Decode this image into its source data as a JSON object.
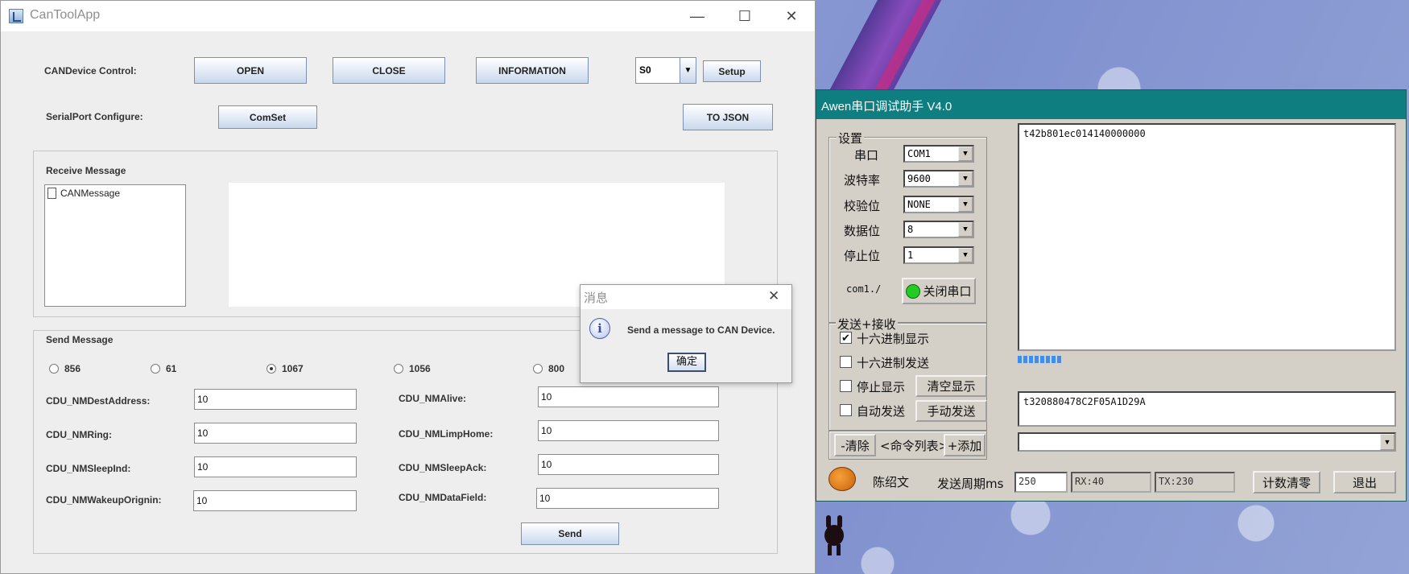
{
  "cantool": {
    "title": "CanToolApp",
    "labels": {
      "candevice_control": "CANDevice Control:",
      "serialport_configure": "SerialPort Configure:",
      "receive_message": "Receive Message",
      "send_message": "Send Message"
    },
    "buttons": {
      "open": "OPEN",
      "close": "CLOSE",
      "information": "INFORMATION",
      "setup": "Setup",
      "comset": "ComSet",
      "to_json": "TO JSON",
      "send": "Send"
    },
    "device_select": "S0",
    "tree_item": "CANMessage",
    "radios": [
      {
        "label": "856",
        "selected": false
      },
      {
        "label": "61",
        "selected": false
      },
      {
        "label": "1067",
        "selected": true
      },
      {
        "label": "1056",
        "selected": false
      },
      {
        "label": "800",
        "selected": false
      }
    ],
    "fields_left": [
      {
        "label": "CDU_NMDestAddress:",
        "value": "10"
      },
      {
        "label": "CDU_NMRing:",
        "value": "10"
      },
      {
        "label": "CDU_NMSleepInd:",
        "value": "10"
      },
      {
        "label": "CDU_NMWakeupOrignin:",
        "value": "10"
      }
    ],
    "fields_right": [
      {
        "label": "CDU_NMAlive:",
        "value": "10"
      },
      {
        "label": "CDU_NMLimpHome:",
        "value": "10"
      },
      {
        "label": "CDU_NMSleepAck:",
        "value": "10"
      },
      {
        "label": "CDU_NMDataField:",
        "value": "10"
      }
    ]
  },
  "dialog": {
    "title": "消息",
    "message": "Send a message to CAN Device.",
    "ok": "确定"
  },
  "awen": {
    "title": "Awen串口调试助手 V4.0",
    "settings_group": "设置",
    "settings": [
      {
        "label": "串口",
        "value": "COM1"
      },
      {
        "label": "波特率",
        "value": "9600"
      },
      {
        "label": "校验位",
        "value": "NONE"
      },
      {
        "label": "数据位",
        "value": "8"
      },
      {
        "label": "停止位",
        "value": "1"
      }
    ],
    "port_status": "com1./",
    "close_port_button": "关闭串口",
    "sendrecv_group": "发送+接收",
    "options": [
      {
        "label": "十六进制显示",
        "checked": true
      },
      {
        "label": "十六进制发送",
        "checked": false
      },
      {
        "label": "停止显示",
        "checked": false
      },
      {
        "label": "自动发送",
        "checked": false
      }
    ],
    "clear_display_button": "清空显示",
    "manual_send_button": "手动发送",
    "cmd_clear": "-清除",
    "cmd_list": "<命令列表>",
    "cmd_add": "+添加",
    "receive_text": "t42b801ec014140000000",
    "send_text": "t320880478C2F05A1D29A",
    "author": "陈绍文",
    "period_label": "发送周期ms",
    "period_value": "250",
    "rx": "RX:40",
    "tx": "TX:230",
    "reset_count_button": "计数清零",
    "exit_button": "退出",
    "progress": 0.12,
    "colors": {
      "titlebar": "#0f7e80",
      "progress": "#3c8ff0",
      "status_led": "#22cc22"
    }
  }
}
